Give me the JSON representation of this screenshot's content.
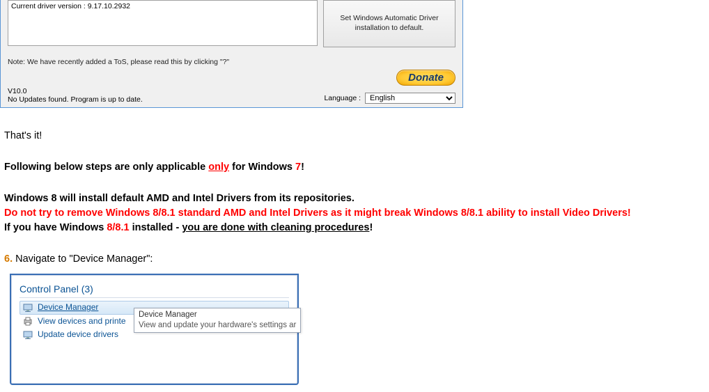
{
  "app": {
    "log_line": "Current driver version : 9.17.10.2932",
    "set_default_label": "Set Windows Automatic Driver installation to default.",
    "note": "Note: We have recently added a ToS, please read this by clicking \"?\"",
    "version": "V10.0",
    "status": "No Updates found. Program is up to date.",
    "language_label": "Language :",
    "language_value": "English",
    "donate": "Donate"
  },
  "article": {
    "thats_it": "That's it!",
    "line2a": "Following below steps are only applicable ",
    "line2b": "only",
    "line2c": " for Windows ",
    "line2d": "7",
    "line2e": "!",
    "line3": "Windows 8 will install default AMD and Intel Drivers from its repositories.",
    "line4": "Do not try to remove Windows 8/8.1 standard AMD and Intel Drivers as it might break Windows 8/8.1 ability to install Video Drivers!",
    "line5a": "If you have Windows ",
    "line5b": "8/8.1",
    "line5c": " installed - ",
    "line5d": "you are done with cleaning procedures",
    "line5e": "!",
    "step_num": "6.",
    "step_text": " Navigate to \"Device Manager\":"
  },
  "cp": {
    "header": "Control Panel (3)",
    "items": [
      {
        "label": "Device Manager"
      },
      {
        "label": "View devices and printe"
      },
      {
        "label": "Update device drivers"
      }
    ],
    "tooltip_title": "Device Manager",
    "tooltip_desc": "View and update your hardware's settings ar"
  }
}
